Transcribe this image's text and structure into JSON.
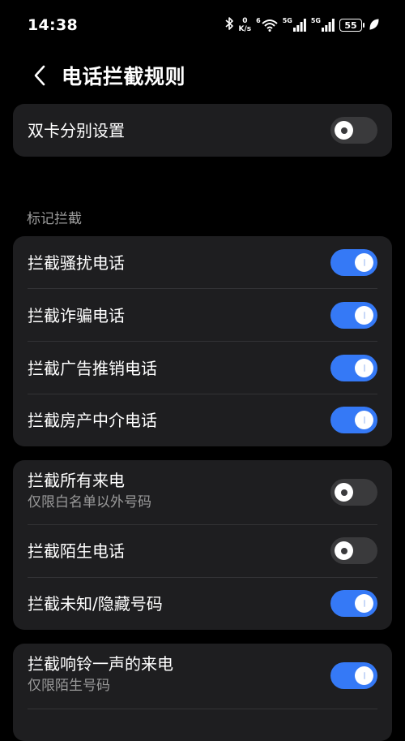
{
  "status_bar": {
    "time": "14:38",
    "speed_value": "0",
    "speed_unit": "K/s",
    "wifi_tag": "6",
    "sim1_tag": "5G",
    "sim2_tag": "5G",
    "battery": "55"
  },
  "header": {
    "title": "电话拦截规则"
  },
  "dual_sim": {
    "label": "双卡分别设置",
    "enabled": false
  },
  "section_marked": {
    "title": "标记拦截"
  },
  "marked_items": [
    {
      "label": "拦截骚扰电话",
      "enabled": true
    },
    {
      "label": "拦截诈骗电话",
      "enabled": true
    },
    {
      "label": "拦截广告推销电话",
      "enabled": true
    },
    {
      "label": "拦截房产中介电话",
      "enabled": true
    }
  ],
  "call_items": [
    {
      "label": "拦截所有来电",
      "sub": "仅限白名单以外号码",
      "enabled": false
    },
    {
      "label": "拦截陌生电话",
      "enabled": false
    },
    {
      "label": "拦截未知/隐藏号码",
      "enabled": true
    }
  ],
  "ring_items": [
    {
      "label": "拦截响铃一声的来电",
      "sub": "仅限陌生号码",
      "enabled": true
    }
  ],
  "colors": {
    "accent": "#3579f6",
    "card": "#1e1e20",
    "background": "#000000"
  }
}
